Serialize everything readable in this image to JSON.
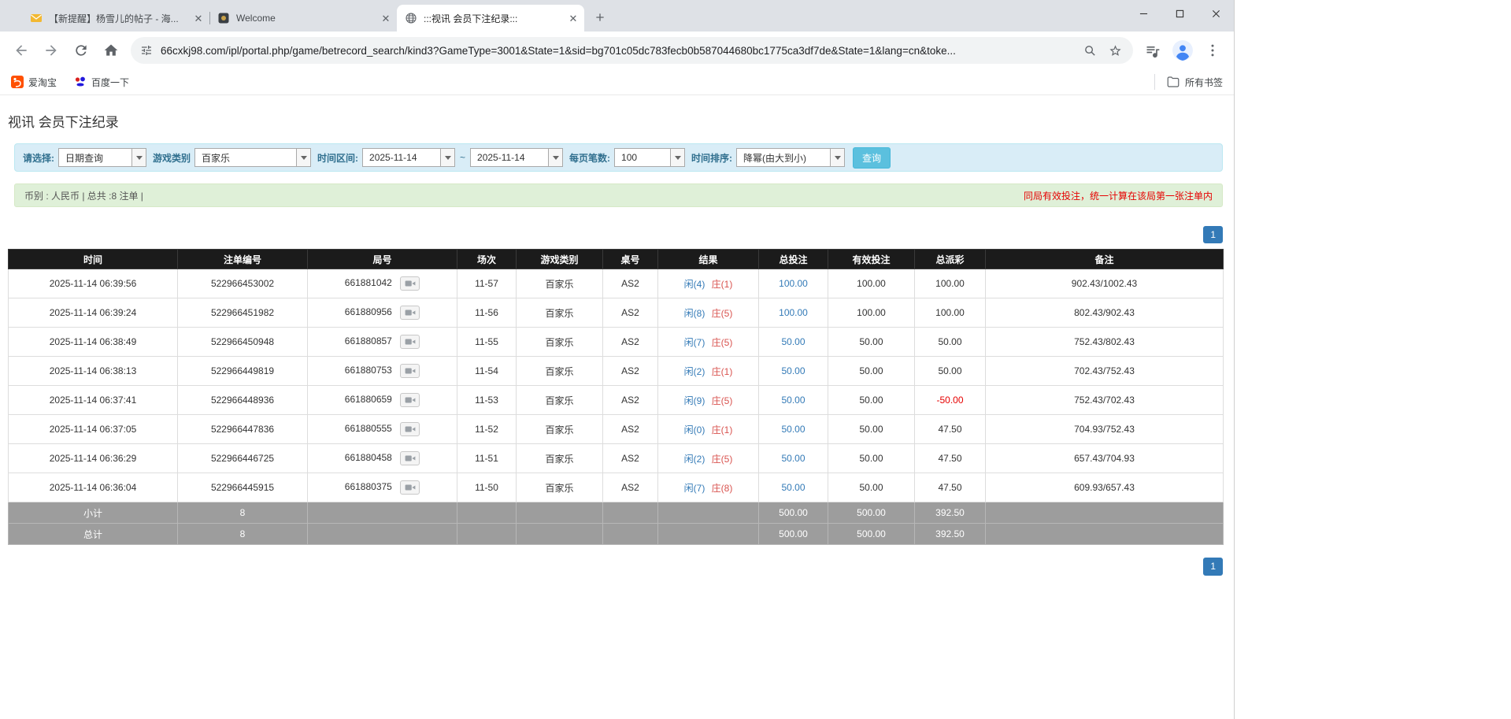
{
  "browser": {
    "tabs": [
      {
        "title": "【新提醒】杨雪儿的帖子 - 海...",
        "active": false
      },
      {
        "title": "Welcome",
        "active": false
      },
      {
        "title": ":::视讯 会员下注纪录:::",
        "active": true
      }
    ],
    "address_bar": {
      "url": "66cxkj98.com/ipl/portal.php/game/betrecord_search/kind3?GameType=3001&State=1&sid=bg701c05dc783fecb0b587044680bc1775ca3df7de&State=1&lang=cn&toke..."
    },
    "bookmarks_bar": {
      "items": [
        {
          "label": "爱淘宝"
        },
        {
          "label": "百度一下"
        }
      ],
      "all_bookmarks_label": "所有书签"
    }
  },
  "page": {
    "title": "视讯 会员下注纪录",
    "filters": {
      "select_label": "请选择:",
      "select_value": "日期查询",
      "game_type_label": "游戏类别",
      "game_type_value": "百家乐",
      "date_range_label": "时间区间:",
      "date_from": "2025-11-14",
      "date_separator": "~",
      "date_to": "2025-11-14",
      "per_page_label": "每页笔数:",
      "per_page_value": "100",
      "sort_label": "时间排序:",
      "sort_value": "降幂(由大到小)",
      "search_button_label": "查询"
    },
    "info_bar": {
      "summary": "币别 : 人民币 | 总共 :8 注单 |",
      "notice": "同局有效投注，统一计算在该局第一张注单内"
    },
    "pagination": {
      "current_page": "1"
    },
    "table": {
      "headers": [
        "时间",
        "注单编号",
        "局号",
        "场次",
        "游戏类别",
        "桌号",
        "结果",
        "总投注",
        "有效投注",
        "总派彩",
        "备注"
      ],
      "rows": [
        {
          "time": "2025-11-14 06:39:56",
          "bet_id": "522966453002",
          "round_id": "661881042",
          "session": "11-57",
          "game": "百家乐",
          "table_no": "AS2",
          "result_player": "闲(4)",
          "result_banker": "庄(1)",
          "total_bet": "100.00",
          "valid_bet": "100.00",
          "payout": "100.00",
          "note": "902.43/1002.43"
        },
        {
          "time": "2025-11-14 06:39:24",
          "bet_id": "522966451982",
          "round_id": "661880956",
          "session": "11-56",
          "game": "百家乐",
          "table_no": "AS2",
          "result_player": "闲(8)",
          "result_banker": "庄(5)",
          "total_bet": "100.00",
          "valid_bet": "100.00",
          "payout": "100.00",
          "note": "802.43/902.43"
        },
        {
          "time": "2025-11-14 06:38:49",
          "bet_id": "522966450948",
          "round_id": "661880857",
          "session": "11-55",
          "game": "百家乐",
          "table_no": "AS2",
          "result_player": "闲(7)",
          "result_banker": "庄(5)",
          "total_bet": "50.00",
          "valid_bet": "50.00",
          "payout": "50.00",
          "note": "752.43/802.43"
        },
        {
          "time": "2025-11-14 06:38:13",
          "bet_id": "522966449819",
          "round_id": "661880753",
          "session": "11-54",
          "game": "百家乐",
          "table_no": "AS2",
          "result_player": "闲(2)",
          "result_banker": "庄(1)",
          "total_bet": "50.00",
          "valid_bet": "50.00",
          "payout": "50.00",
          "note": "702.43/752.43"
        },
        {
          "time": "2025-11-14 06:37:41",
          "bet_id": "522966448936",
          "round_id": "661880659",
          "session": "11-53",
          "game": "百家乐",
          "table_no": "AS2",
          "result_player": "闲(9)",
          "result_banker": "庄(5)",
          "total_bet": "50.00",
          "valid_bet": "50.00",
          "payout": "-50.00",
          "note": "752.43/702.43"
        },
        {
          "time": "2025-11-14 06:37:05",
          "bet_id": "522966447836",
          "round_id": "661880555",
          "session": "11-52",
          "game": "百家乐",
          "table_no": "AS2",
          "result_player": "闲(0)",
          "result_banker": "庄(1)",
          "total_bet": "50.00",
          "valid_bet": "50.00",
          "payout": "47.50",
          "note": "704.93/752.43"
        },
        {
          "time": "2025-11-14 06:36:29",
          "bet_id": "522966446725",
          "round_id": "661880458",
          "session": "11-51",
          "game": "百家乐",
          "table_no": "AS2",
          "result_player": "闲(2)",
          "result_banker": "庄(5)",
          "total_bet": "50.00",
          "valid_bet": "50.00",
          "payout": "47.50",
          "note": "657.43/704.93"
        },
        {
          "time": "2025-11-14 06:36:04",
          "bet_id": "522966445915",
          "round_id": "661880375",
          "session": "11-50",
          "game": "百家乐",
          "table_no": "AS2",
          "result_player": "闲(7)",
          "result_banker": "庄(8)",
          "total_bet": "50.00",
          "valid_bet": "50.00",
          "payout": "47.50",
          "note": "609.93/657.43"
        }
      ],
      "summary_rows": [
        {
          "label": "小计",
          "count": "8",
          "total_bet": "500.00",
          "valid_bet": "500.00",
          "payout": "392.50"
        },
        {
          "label": "总计",
          "count": "8",
          "total_bet": "500.00",
          "valid_bet": "500.00",
          "payout": "392.50"
        }
      ]
    },
    "colors": {
      "player_blue": "#337ab7",
      "banker_red": "#d9534f",
      "bet_link_blue": "#337ab7",
      "negative_red": "#e60000",
      "search_button_bg": "#5bc0de",
      "pagination_bg": "#337ab7",
      "filter_bar_bg": "#d9edf7",
      "info_bar_bg": "#dff0d8",
      "table_header_bg": "#1b1b1b",
      "summary_row_bg": "#9d9d9d"
    }
  }
}
